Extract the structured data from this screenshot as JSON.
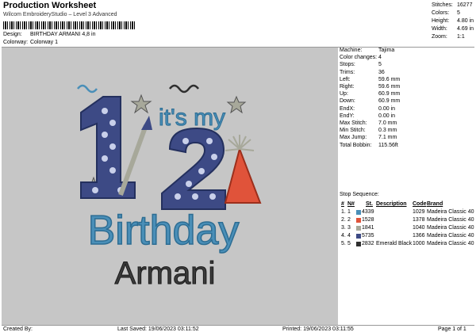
{
  "header": {
    "title": "Production Worksheet",
    "subtitle": "Wilcom EmbroideryStudio – Level 3 Advanced",
    "design_label": "Design:",
    "design_value": "BIRTHDAY ARMANI 4,8 in",
    "colorway_label": "Colorway:",
    "colorway_value": "Colorway 1"
  },
  "stats": [
    {
      "label": "Stitches:",
      "value": "16277"
    },
    {
      "label": "Colors:",
      "value": "5"
    },
    {
      "label": "Height:",
      "value": "4.80 in"
    },
    {
      "label": "Width:",
      "value": "4.69 in"
    },
    {
      "label": "Zoom:",
      "value": "1:1"
    }
  ],
  "machine": [
    {
      "label": "Machine:",
      "value": "Tajima"
    },
    {
      "label": "Color changes:",
      "value": "4"
    },
    {
      "label": "Stops:",
      "value": "5"
    },
    {
      "label": "Trims:",
      "value": "36"
    },
    {
      "label": "Left:",
      "value": "59.6 mm"
    },
    {
      "label": "Right:",
      "value": "59.6 mm"
    },
    {
      "label": "Up:",
      "value": "60.9 mm"
    },
    {
      "label": "Down:",
      "value": "60.9 mm"
    },
    {
      "label": "EndX:",
      "value": "0.00 in"
    },
    {
      "label": "EndY:",
      "value": "0.00 in"
    },
    {
      "label": "Max Stitch:",
      "value": "7.0 mm"
    },
    {
      "label": "Min Stitch:",
      "value": "0.3 mm"
    },
    {
      "label": "Max Jump:",
      "value": "7.1 mm"
    },
    {
      "label": "Total Bobbin:",
      "value": "115.56ft"
    }
  ],
  "sequence": {
    "title": "Stop Sequence:",
    "headers": [
      "#",
      "N#",
      "St.",
      "Description",
      "Code",
      "Brand"
    ],
    "rows": [
      {
        "num": "1.",
        "n": "1",
        "color": "#4a8fb8",
        "st": "4339",
        "desc": "",
        "code": "1029",
        "brand": "Madeira Classic 40"
      },
      {
        "num": "2.",
        "n": "2",
        "color": "#e0533a",
        "st": "1528",
        "desc": "",
        "code": "1378",
        "brand": "Madeira Classic 40"
      },
      {
        "num": "3.",
        "n": "3",
        "color": "#a7a89a",
        "st": "1841",
        "desc": "",
        "code": "1040",
        "brand": "Madeira Classic 40"
      },
      {
        "num": "4.",
        "n": "4",
        "color": "#3d4a85",
        "st": "5735",
        "desc": "",
        "code": "1366",
        "brand": "Madeira Classic 40"
      },
      {
        "num": "5.",
        "n": "5",
        "color": "#2f2f2f",
        "st": "2832",
        "desc": "Emerald Black",
        "code": "1000",
        "brand": "Madeira Classic 40"
      }
    ]
  },
  "artwork": {
    "big_1": "1",
    "big_2": "2",
    "its_my": "it's my",
    "birthday": "Birthday",
    "name": "Armani"
  },
  "footer": {
    "created": "Created By:",
    "saved": "Last Saved: 19/06/2023 03:11:52",
    "printed": "Printed: 19/06/2023 03:11:55",
    "page": "Page 1 of 1"
  }
}
